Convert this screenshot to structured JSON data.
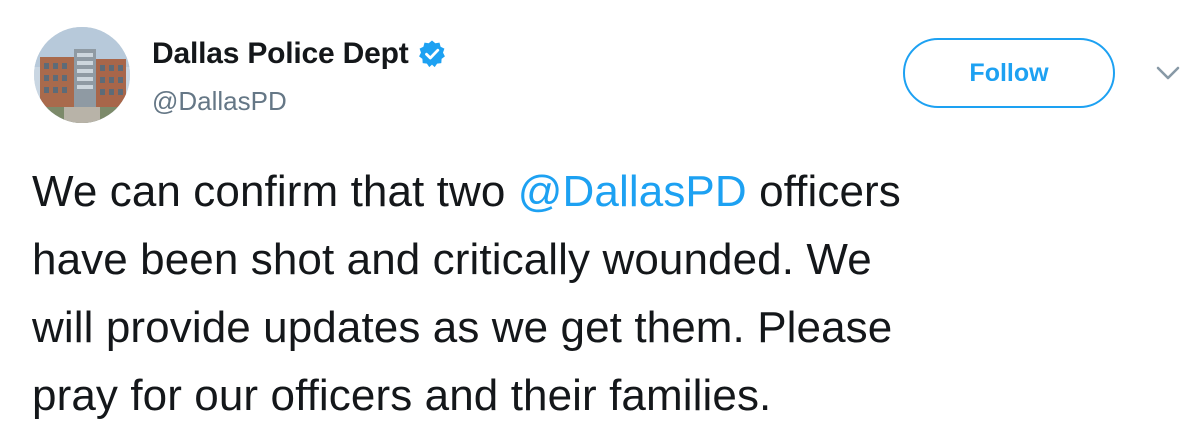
{
  "author": {
    "display_name": "Dallas Police Dept",
    "handle": "@DallasPD",
    "verified": true,
    "avatar_icon": "police-building-avatar"
  },
  "follow_button": {
    "label": "Follow"
  },
  "menu": {
    "icon": "chevron-down-icon"
  },
  "tweet": {
    "lines": [
      {
        "before": "We can confirm that two ",
        "mention": "@DallasPD",
        "after": " officers"
      },
      {
        "text": "have been shot and critically wounded. We"
      },
      {
        "text": "will provide updates as we get them. Please"
      },
      {
        "text": "pray for our officers and their families."
      }
    ]
  },
  "colors": {
    "accent": "#1da1f2",
    "text": "#14171a",
    "secondary_text": "#657786"
  }
}
